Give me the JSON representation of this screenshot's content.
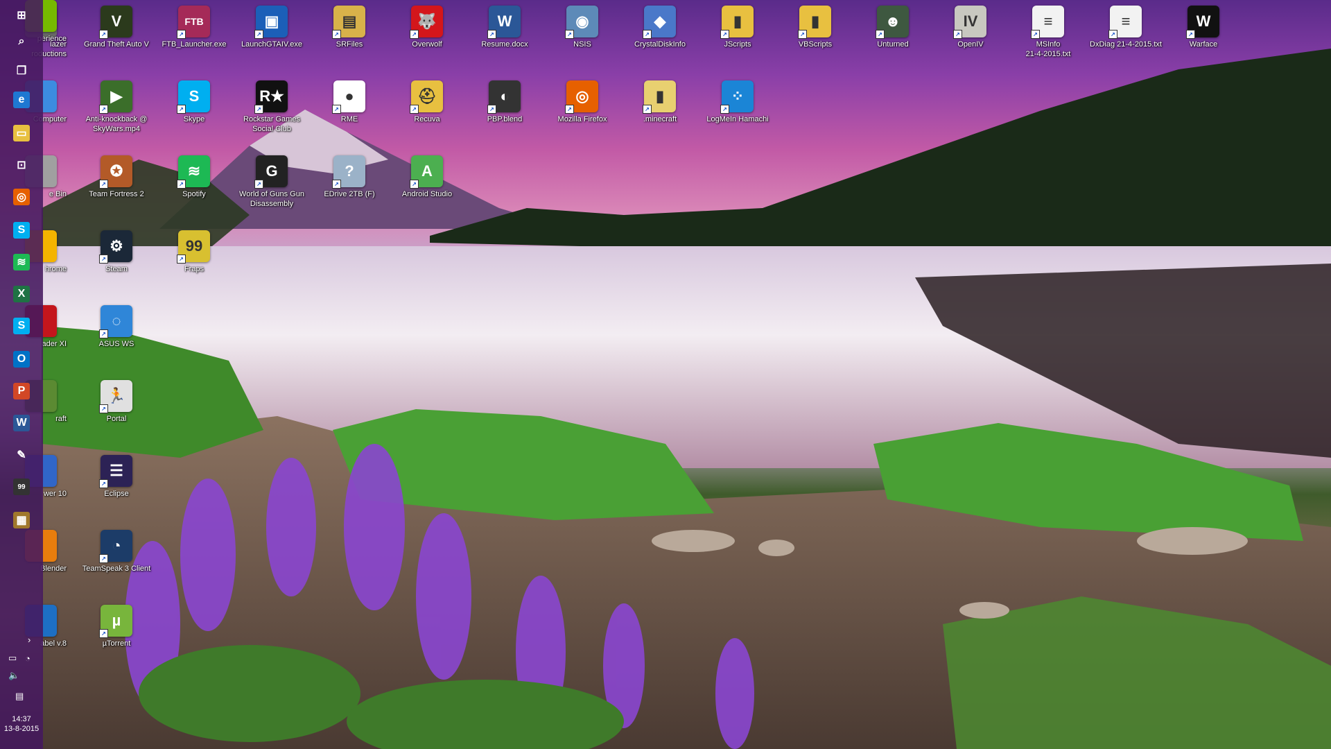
{
  "desktop_icons": [
    {
      "label": "Grand Theft Auto V",
      "icon": "gta-v-icon",
      "color": "#2b3a1c",
      "glyph": "V"
    },
    {
      "label": "FTB_Launcher.exe",
      "icon": "ftb-launcher-icon",
      "color": "#a52a58",
      "glyph": "FTB"
    },
    {
      "label": "LaunchGTAIV.exe",
      "icon": "gta-iv-launcher-icon",
      "color": "#1c5fb8",
      "glyph": "▣"
    },
    {
      "label": "SRFiles",
      "icon": "folder-icon",
      "color": "#d8b24a",
      "glyph": "▤"
    },
    {
      "label": "Overwolf",
      "icon": "overwolf-icon",
      "color": "#d4161b",
      "glyph": "🐺"
    },
    {
      "label": "Resume.docx",
      "icon": "word-document-icon",
      "color": "#2b5797",
      "glyph": "W"
    },
    {
      "label": "NSIS",
      "icon": "nsis-icon",
      "color": "#5d8ab8",
      "glyph": "◉"
    },
    {
      "label": "CrystalDiskInfo",
      "icon": "crystaldiskinfo-icon",
      "color": "#4a78c9",
      "glyph": "◆"
    },
    {
      "label": "JScripts",
      "icon": "folder-icon",
      "color": "#e8c040",
      "glyph": "▮"
    },
    {
      "label": "VBScripts",
      "icon": "folder-icon",
      "color": "#e8c040",
      "glyph": "▮"
    },
    {
      "label": "Unturned",
      "icon": "unturned-icon",
      "color": "#3e5840",
      "glyph": "☻"
    },
    {
      "label": "OpenIV",
      "icon": "openiv-icon",
      "color": "#c8c8c0",
      "glyph": "IV"
    },
    {
      "label": "MSInfo\n21-4-2015.txt",
      "icon": "text-file-icon",
      "color": "#f2f2f2",
      "glyph": "≡"
    },
    {
      "label": "DxDiag 21-4-2015.txt",
      "icon": "text-file-icon",
      "color": "#f2f2f2",
      "glyph": "≡"
    },
    {
      "label": "Warface",
      "icon": "warface-icon",
      "color": "#111111",
      "glyph": "W"
    },
    {
      "label": "Anti-knockback @ SkyWars.mp4",
      "icon": "video-file-icon",
      "color": "#3b6e2a",
      "glyph": "▶"
    },
    {
      "label": "Skype",
      "icon": "skype-icon",
      "color": "#00aff0",
      "glyph": "S"
    },
    {
      "label": "Rockstar Games Social Club",
      "icon": "rockstar-icon",
      "color": "#111111",
      "glyph": "R★"
    },
    {
      "label": "RME",
      "icon": "rme-icon",
      "color": "#ffffff",
      "glyph": "●"
    },
    {
      "label": "Recuva",
      "icon": "recuva-icon",
      "color": "#e8c040",
      "glyph": "⛑"
    },
    {
      "label": "PBP.blend",
      "icon": "blend-file-icon",
      "color": "#333333",
      "glyph": "◐"
    },
    {
      "label": "Mozilla Firefox",
      "icon": "firefox-icon",
      "color": "#e66000",
      "glyph": "◎"
    },
    {
      "label": ".minecraft",
      "icon": "folder-icon",
      "color": "#e8d070",
      "glyph": "▮"
    },
    {
      "label": "LogMeIn Hamachi",
      "icon": "hamachi-icon",
      "color": "#1b85d6",
      "glyph": "⁘"
    },
    {
      "label": "Team Fortress 2",
      "icon": "team-fortress-icon",
      "color": "#b35a28",
      "glyph": "✪"
    },
    {
      "label": "Spotify",
      "icon": "spotify-icon",
      "color": "#1db954",
      "glyph": "≋"
    },
    {
      "label": "World of Guns Gun Disassembly",
      "icon": "world-of-guns-icon",
      "color": "#222222",
      "glyph": "G"
    },
    {
      "label": "EDrive 2TB (F)",
      "icon": "drive-icon",
      "color": "#9bb2c8",
      "glyph": "?"
    },
    {
      "label": "Android Studio",
      "icon": "android-studio-icon",
      "color": "#4caf50",
      "glyph": "A"
    },
    {
      "label": "Steam",
      "icon": "steam-icon",
      "color": "#1b2838",
      "glyph": "⚙"
    },
    {
      "label": "Fraps",
      "icon": "fraps-icon",
      "color": "#d8c030",
      "glyph": "99"
    },
    {
      "label": "ASUS WS",
      "icon": "asus-ws-icon",
      "color": "#2f86d8",
      "glyph": "◌"
    },
    {
      "label": "Portal",
      "icon": "portal-icon",
      "color": "#e0e0e0",
      "glyph": "🏃"
    },
    {
      "label": "Eclipse",
      "icon": "eclipse-icon",
      "color": "#2c2255",
      "glyph": "☰"
    },
    {
      "label": "TeamSpeak 3 Client",
      "icon": "teamspeak-icon",
      "color": "#1c3c68",
      "glyph": "◔"
    },
    {
      "label": "µTorrent",
      "icon": "utorrent-icon",
      "color": "#78b53c",
      "glyph": "µ"
    }
  ],
  "partial_icons": [
    {
      "label": "lazer\nroductions",
      "icon": "app-icon",
      "color": "#6a6a6a"
    },
    {
      "label": "Computer",
      "icon": "computer-icon",
      "color": "#3c8ce0"
    },
    {
      "label": "e Bin",
      "icon": "recycle-bin-icon",
      "color": "#a0a0a0"
    },
    {
      "label": "hrome",
      "icon": "chrome-icon",
      "color": "#f4b400"
    },
    {
      "label": "ader XI",
      "icon": "adobe-reader-icon",
      "color": "#c4161c"
    },
    {
      "label": "raft",
      "icon": "minecraft-icon",
      "color": "#5b8a32"
    },
    {
      "label": "wer 10",
      "icon": "app-icon",
      "color": "#3066c8"
    },
    {
      "label": "Blender",
      "icon": "blender-icon",
      "color": "#e87d0d"
    },
    {
      "label": "abel v.8",
      "icon": "app-icon",
      "color": "#1d6fc4"
    },
    {
      "label": "perience",
      "icon": "nvidia-experience-icon",
      "color": "#76b900"
    }
  ],
  "sidebar": [
    {
      "icon": "windows-logo-icon",
      "glyph": "⊞",
      "color": "transparent"
    },
    {
      "icon": "search-icon",
      "glyph": "⌕",
      "color": "transparent"
    },
    {
      "icon": "task-view-icon",
      "glyph": "❐",
      "color": "transparent"
    },
    {
      "icon": "edge-icon",
      "glyph": "e",
      "color": "#1e78d2"
    },
    {
      "icon": "file-explorer-icon",
      "glyph": "▭",
      "color": "#e8c040"
    },
    {
      "icon": "store-icon",
      "glyph": "⊡",
      "color": "transparent"
    },
    {
      "icon": "firefox-icon",
      "glyph": "◎",
      "color": "#e66000"
    },
    {
      "icon": "skype-icon",
      "glyph": "S",
      "color": "#00aff0"
    },
    {
      "icon": "spotify-icon",
      "glyph": "≋",
      "color": "#1db954"
    },
    {
      "icon": "excel-icon",
      "glyph": "X",
      "color": "#1f7244"
    },
    {
      "icon": "skype-icon",
      "glyph": "S",
      "color": "#00aff0"
    },
    {
      "icon": "outlook-icon",
      "glyph": "O",
      "color": "#0072c6"
    },
    {
      "icon": "powerpoint-icon",
      "glyph": "P",
      "color": "#d24726"
    },
    {
      "icon": "word-icon",
      "glyph": "W",
      "color": "#2b5797"
    },
    {
      "icon": "paint-icon",
      "glyph": "✎",
      "color": "transparent"
    },
    {
      "icon": "fraps-icon",
      "glyph": "99",
      "color": "#333333"
    },
    {
      "icon": "package-icon",
      "glyph": "▦",
      "color": "#a0782c"
    }
  ],
  "taskbar": {
    "time": "14:37",
    "date": "13-8-2015"
  }
}
